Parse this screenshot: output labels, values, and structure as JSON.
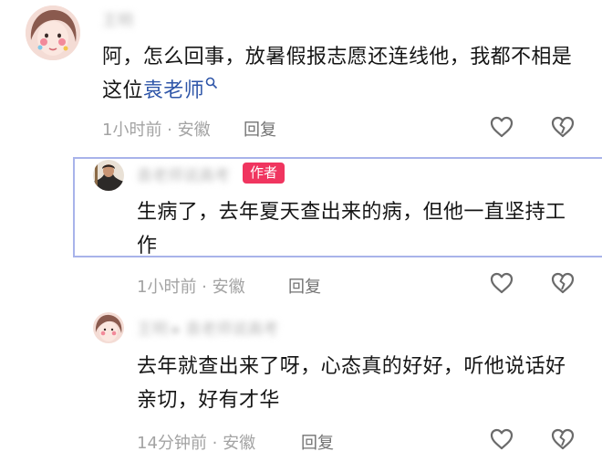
{
  "comments": [
    {
      "username": "王明",
      "content": "阿，怎么回事，放暑假报志愿还连线他，我都不相是这位",
      "mention": "袁老师",
      "meta": "1小时前 · 安徽",
      "reply_label": "回复"
    },
    {
      "username": "袁老师说高考",
      "author_badge": "作者",
      "content": "生病了，去年夏天查出来的病，但他一直坚持工作",
      "meta": "1小时前 · 安徽",
      "reply_label": "回复"
    },
    {
      "username": "王明  ▸  袁老师说高考",
      "content": "去年就查出来了呀，心态真的好好，听他说话好亲切，好有才华",
      "meta": "14分钟前 · 安徽",
      "reply_label": "回复"
    }
  ],
  "colors": {
    "mention": "#2e55a8",
    "author_badge": "#f0355f",
    "highlight_border": "#a8b3ea"
  },
  "icons": [
    "like-heart-icon",
    "dislike-broken-heart-icon",
    "search-icon"
  ]
}
